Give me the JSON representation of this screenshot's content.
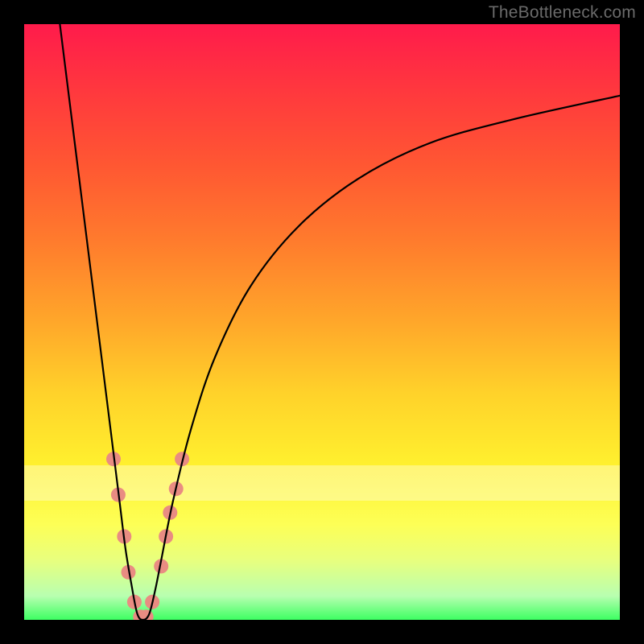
{
  "watermark": "TheBottleneck.com",
  "chart_data": {
    "type": "line",
    "title": "",
    "xlabel": "",
    "ylabel": "",
    "xlim": [
      0,
      100
    ],
    "ylim": [
      0,
      100
    ],
    "grid": false,
    "legend": false,
    "white_band_y": [
      20,
      26
    ],
    "series": [
      {
        "name": "bottleneck-curve",
        "color": "#000000",
        "x": [
          6,
          8,
          10,
          12,
          14,
          15,
          16,
          17,
          18,
          19,
          20,
          21,
          22,
          23,
          25,
          28,
          32,
          38,
          46,
          56,
          68,
          82,
          100
        ],
        "y": [
          100,
          84,
          68,
          52,
          36,
          28,
          20,
          12,
          6,
          1,
          0,
          1,
          5,
          10,
          20,
          32,
          44,
          56,
          66,
          74,
          80,
          84,
          88
        ]
      }
    ],
    "markers": {
      "name": "highlight-points",
      "color": "#e98c82",
      "radius_px": 9,
      "points": [
        {
          "x": 15.0,
          "y": 27.0
        },
        {
          "x": 15.8,
          "y": 21.0
        },
        {
          "x": 16.8,
          "y": 14.0
        },
        {
          "x": 17.5,
          "y": 8.0
        },
        {
          "x": 18.5,
          "y": 3.0
        },
        {
          "x": 19.5,
          "y": 0.5
        },
        {
          "x": 20.5,
          "y": 0.5
        },
        {
          "x": 21.5,
          "y": 3.0
        },
        {
          "x": 23.0,
          "y": 9.0
        },
        {
          "x": 23.8,
          "y": 14.0
        },
        {
          "x": 24.5,
          "y": 18.0
        },
        {
          "x": 25.5,
          "y": 22.0
        },
        {
          "x": 26.5,
          "y": 27.0
        }
      ]
    }
  }
}
